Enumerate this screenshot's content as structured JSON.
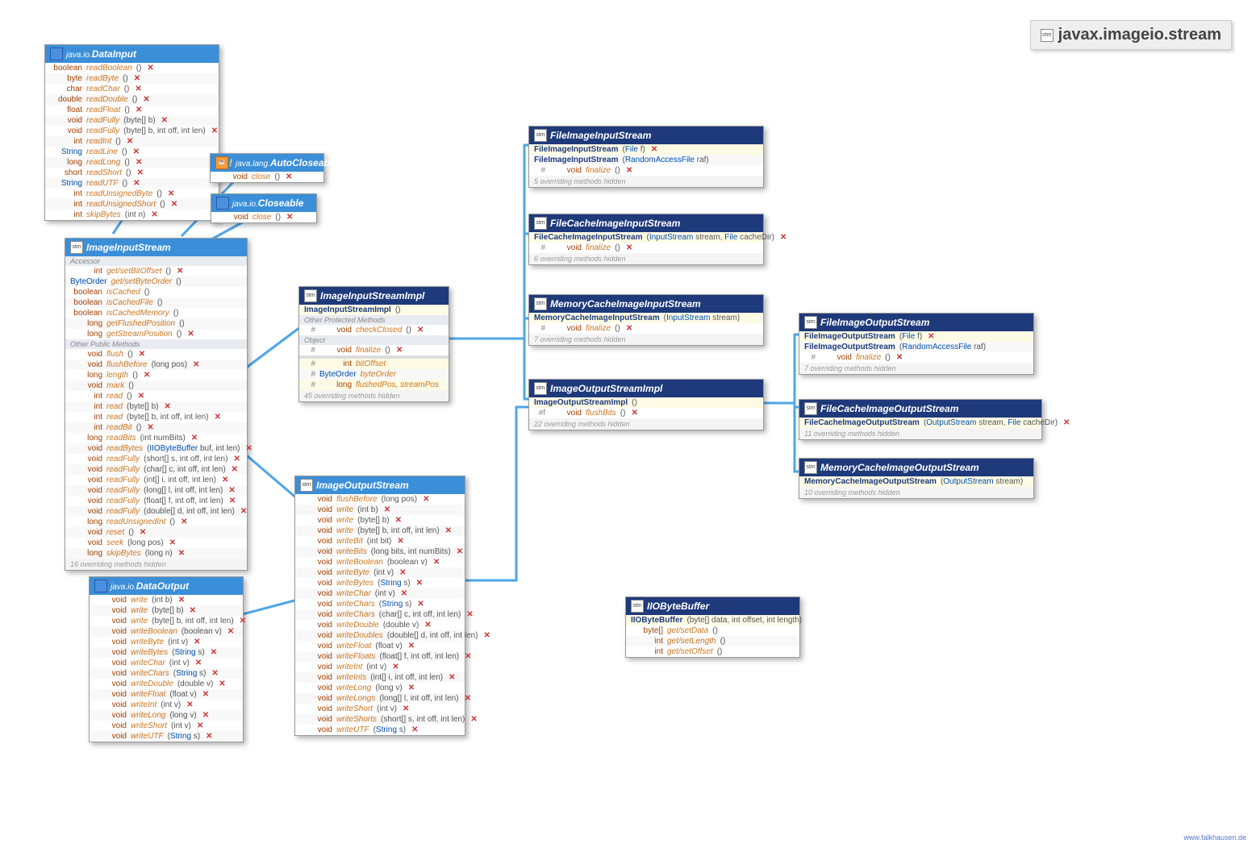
{
  "title": "javax.imageio.stream",
  "watermark": "www.falkhausen.de",
  "boxes": {
    "dataInput": {
      "pkg": "java.io.",
      "name": "DataInput",
      "rows": [
        {
          "ret": "boolean",
          "m": "readBoolean",
          "p": "()",
          "t": true
        },
        {
          "ret": "byte",
          "m": "readByte",
          "p": "()",
          "t": true
        },
        {
          "ret": "char",
          "m": "readChar",
          "p": "()",
          "t": true
        },
        {
          "ret": "double",
          "m": "readDouble",
          "p": "()",
          "t": true
        },
        {
          "ret": "float",
          "m": "readFloat",
          "p": "()",
          "t": true
        },
        {
          "ret": "void",
          "m": "readFully",
          "p": "(byte[] b)",
          "t": true
        },
        {
          "ret": "void",
          "m": "readFully",
          "p": "(byte[] b, int off, int len)",
          "t": true
        },
        {
          "ret": "int",
          "m": "readInt",
          "p": "()",
          "t": true
        },
        {
          "ret": "String",
          "m": "readLine",
          "p": "()",
          "t": true,
          "retblue": true
        },
        {
          "ret": "long",
          "m": "readLong",
          "p": "()",
          "t": true
        },
        {
          "ret": "short",
          "m": "readShort",
          "p": "()",
          "t": true
        },
        {
          "ret": "String",
          "m": "readUTF",
          "p": "()",
          "t": true,
          "retblue": true
        },
        {
          "ret": "int",
          "m": "readUnsignedByte",
          "p": "()",
          "t": true
        },
        {
          "ret": "int",
          "m": "readUnsignedShort",
          "p": "()",
          "t": true
        },
        {
          "ret": "int",
          "m": "skipBytes",
          "p": "(int n)",
          "t": true
        }
      ]
    },
    "autoCloseable": {
      "pkg": "java.lang.",
      "name": "AutoCloseable",
      "rows": [
        {
          "ret": "void",
          "m": "close",
          "p": "()",
          "t": true
        }
      ]
    },
    "closeable": {
      "pkg": "java.io.",
      "name": "Closeable",
      "rows": [
        {
          "ret": "void",
          "m": "close",
          "p": "()",
          "t": true
        }
      ]
    },
    "imageInputStream": {
      "name": "ImageInputStream",
      "sec1": "Accessor",
      "rows1": [
        {
          "ret": "int",
          "m": "get/setBitOffset",
          "p": "()",
          "t": true
        },
        {
          "ret": "ByteOrder",
          "m": "get/setByteOrder",
          "p": "()",
          "retblue": true
        },
        {
          "ret": "boolean",
          "m": "isCached",
          "p": "()"
        },
        {
          "ret": "boolean",
          "m": "isCachedFile",
          "p": "()"
        },
        {
          "ret": "boolean",
          "m": "isCachedMemory",
          "p": "()"
        },
        {
          "ret": "long",
          "m": "getFlushedPosition",
          "p": "()"
        },
        {
          "ret": "long",
          "m": "getStreamPosition",
          "p": "()",
          "t": true
        }
      ],
      "sec2": "Other Public Methods",
      "rows2": [
        {
          "ret": "void",
          "m": "flush",
          "p": "()",
          "t": true
        },
        {
          "ret": "void",
          "m": "flushBefore",
          "p": "(long pos)",
          "t": true
        },
        {
          "ret": "long",
          "m": "length",
          "p": "()",
          "t": true
        },
        {
          "ret": "void",
          "m": "mark",
          "p": "()"
        },
        {
          "ret": "int",
          "m": "read",
          "p": "()",
          "t": true
        },
        {
          "ret": "int",
          "m": "read",
          "p": "(byte[] b)",
          "t": true
        },
        {
          "ret": "int",
          "m": "read",
          "p": "(byte[] b, int off, int len)",
          "t": true
        },
        {
          "ret": "int",
          "m": "readBit",
          "p": "()",
          "t": true
        },
        {
          "ret": "long",
          "m": "readBits",
          "p": "(int numBits)",
          "t": true
        },
        {
          "ret": "void",
          "m": "readBytes",
          "p": "(IIOByteBuffer buf, int len)",
          "t": true
        },
        {
          "ret": "void",
          "m": "readFully",
          "p": "(short[] s, int off, int len)",
          "t": true
        },
        {
          "ret": "void",
          "m": "readFully",
          "p": "(char[] c, int off, int len)",
          "t": true
        },
        {
          "ret": "void",
          "m": "readFully",
          "p": "(int[] i, int off, int len)",
          "t": true
        },
        {
          "ret": "void",
          "m": "readFully",
          "p": "(long[] l, int off, int len)",
          "t": true
        },
        {
          "ret": "void",
          "m": "readFully",
          "p": "(float[] f, int off, int len)",
          "t": true
        },
        {
          "ret": "void",
          "m": "readFully",
          "p": "(double[] d, int off, int len)",
          "t": true
        },
        {
          "ret": "long",
          "m": "readUnsignedInt",
          "p": "()",
          "t": true
        },
        {
          "ret": "void",
          "m": "reset",
          "p": "()",
          "t": true
        },
        {
          "ret": "void",
          "m": "seek",
          "p": "(long pos)",
          "t": true
        },
        {
          "ret": "long",
          "m": "skipBytes",
          "p": "(long n)",
          "t": true
        }
      ],
      "note": "16 overriding methods hidden"
    },
    "dataOutput": {
      "pkg": "java.io.",
      "name": "DataOutput",
      "rows": [
        {
          "ret": "void",
          "m": "write",
          "p": "(int b)",
          "t": true
        },
        {
          "ret": "void",
          "m": "write",
          "p": "(byte[] b)",
          "t": true
        },
        {
          "ret": "void",
          "m": "write",
          "p": "(byte[] b, int off, int len)",
          "t": true
        },
        {
          "ret": "void",
          "m": "writeBoolean",
          "p": "(boolean v)",
          "t": true
        },
        {
          "ret": "void",
          "m": "writeByte",
          "p": "(int v)",
          "t": true
        },
        {
          "ret": "void",
          "m": "writeBytes",
          "p": "(String s)",
          "t": true
        },
        {
          "ret": "void",
          "m": "writeChar",
          "p": "(int v)",
          "t": true
        },
        {
          "ret": "void",
          "m": "writeChars",
          "p": "(String s)",
          "t": true
        },
        {
          "ret": "void",
          "m": "writeDouble",
          "p": "(double v)",
          "t": true
        },
        {
          "ret": "void",
          "m": "writeFloat",
          "p": "(float v)",
          "t": true
        },
        {
          "ret": "void",
          "m": "writeInt",
          "p": "(int v)",
          "t": true
        },
        {
          "ret": "void",
          "m": "writeLong",
          "p": "(long v)",
          "t": true
        },
        {
          "ret": "void",
          "m": "writeShort",
          "p": "(int v)",
          "t": true
        },
        {
          "ret": "void",
          "m": "writeUTF",
          "p": "(String s)",
          "t": true
        }
      ]
    },
    "imageInputStreamImpl": {
      "name": "ImageInputStreamImpl",
      "ctor": [
        {
          "m": "ImageInputStreamImpl",
          "p": "()"
        }
      ],
      "sec1": "Other Protected Methods",
      "rows1": [
        {
          "pref": "#",
          "ret": "void",
          "m": "checkClosed",
          "p": "()",
          "t": true
        }
      ],
      "sec2": "Object",
      "rows2": [
        {
          "pref": "#",
          "ret": "void",
          "m": "finalize",
          "p": "()",
          "t": true
        }
      ],
      "fields": [
        {
          "pref": "#",
          "ret": "int",
          "m": "bitOffset"
        },
        {
          "pref": "#",
          "ret": "ByteOrder",
          "m": "byteOrder",
          "retblue": true
        },
        {
          "pref": "#",
          "ret": "long",
          "m": "flushedPos, streamPos"
        }
      ],
      "note": "45 overriding methods hidden"
    },
    "imageOutputStream": {
      "name": "ImageOutputStream",
      "rows": [
        {
          "ret": "void",
          "m": "flushBefore",
          "p": "(long pos)",
          "t": true
        },
        {
          "ret": "void",
          "m": "write",
          "p": "(int b)",
          "t": true
        },
        {
          "ret": "void",
          "m": "write",
          "p": "(byte[] b)",
          "t": true
        },
        {
          "ret": "void",
          "m": "write",
          "p": "(byte[] b, int off, int len)",
          "t": true
        },
        {
          "ret": "void",
          "m": "writeBit",
          "p": "(int bit)",
          "t": true
        },
        {
          "ret": "void",
          "m": "writeBits",
          "p": "(long bits, int numBits)",
          "t": true
        },
        {
          "ret": "void",
          "m": "writeBoolean",
          "p": "(boolean v)",
          "t": true
        },
        {
          "ret": "void",
          "m": "writeByte",
          "p": "(int v)",
          "t": true
        },
        {
          "ret": "void",
          "m": "writeBytes",
          "p": "(String s)",
          "t": true
        },
        {
          "ret": "void",
          "m": "writeChar",
          "p": "(int v)",
          "t": true
        },
        {
          "ret": "void",
          "m": "writeChars",
          "p": "(String s)",
          "t": true
        },
        {
          "ret": "void",
          "m": "writeChars",
          "p": "(char[] c, int off, int len)",
          "t": true
        },
        {
          "ret": "void",
          "m": "writeDouble",
          "p": "(double v)",
          "t": true
        },
        {
          "ret": "void",
          "m": "writeDoubles",
          "p": "(double[] d, int off, int len)",
          "t": true
        },
        {
          "ret": "void",
          "m": "writeFloat",
          "p": "(float v)",
          "t": true
        },
        {
          "ret": "void",
          "m": "writeFloats",
          "p": "(float[] f, int off, int len)",
          "t": true
        },
        {
          "ret": "void",
          "m": "writeInt",
          "p": "(int v)",
          "t": true
        },
        {
          "ret": "void",
          "m": "writeInts",
          "p": "(int[] i, int off, int len)",
          "t": true
        },
        {
          "ret": "void",
          "m": "writeLong",
          "p": "(long v)",
          "t": true
        },
        {
          "ret": "void",
          "m": "writeLongs",
          "p": "(long[] l, int off, int len)",
          "t": true
        },
        {
          "ret": "void",
          "m": "writeShort",
          "p": "(int v)",
          "t": true
        },
        {
          "ret": "void",
          "m": "writeShorts",
          "p": "(short[] s, int off, int len)",
          "t": true
        },
        {
          "ret": "void",
          "m": "writeUTF",
          "p": "(String s)",
          "t": true
        }
      ]
    },
    "fileImageInputStream": {
      "name": "FileImageInputStream",
      "ctor": [
        {
          "m": "FileImageInputStream",
          "p": "(File f)",
          "t": true
        },
        {
          "m": "FileImageInputStream",
          "p": "(RandomAccessFile raf)"
        }
      ],
      "rows": [
        {
          "pref": "#",
          "ret": "void",
          "m": "finalize",
          "p": "()",
          "t": true
        }
      ],
      "note": "5 overriding methods hidden"
    },
    "fileCacheImageInputStream": {
      "name": "FileCacheImageInputStream",
      "ctor": [
        {
          "m": "FileCacheImageInputStream",
          "p": "(InputStream stream, File cacheDir)",
          "t": true
        }
      ],
      "rows": [
        {
          "pref": "#",
          "ret": "void",
          "m": "finalize",
          "p": "()",
          "t": true
        }
      ],
      "note": "6 overriding methods hidden"
    },
    "memoryCacheImageInputStream": {
      "name": "MemoryCacheImageInputStream",
      "ctor": [
        {
          "m": "MemoryCacheImageInputStream",
          "p": "(InputStream stream)"
        }
      ],
      "rows": [
        {
          "pref": "#",
          "ret": "void",
          "m": "finalize",
          "p": "()",
          "t": true
        }
      ],
      "note": "7 overriding methods hidden"
    },
    "imageOutputStreamImpl": {
      "name": "ImageOutputStreamImpl",
      "ctor": [
        {
          "m": "ImageOutputStreamImpl",
          "p": "()"
        }
      ],
      "rows": [
        {
          "pref": "#f",
          "ret": "void",
          "m": "flushBits",
          "p": "()",
          "t": true
        }
      ],
      "note": "22 overriding methods hidden"
    },
    "iioByteBuffer": {
      "name": "IIOByteBuffer",
      "ctor": [
        {
          "m": "IIOByteBuffer",
          "p": "(byte[] data, int offset, int length)"
        }
      ],
      "rows": [
        {
          "ret": "byte[]",
          "m": "get/setData",
          "p": "()"
        },
        {
          "ret": "int",
          "m": "get/setLength",
          "p": "()"
        },
        {
          "ret": "int",
          "m": "get/setOffset",
          "p": "()"
        }
      ]
    },
    "fileImageOutputStream": {
      "name": "FileImageOutputStream",
      "ctor": [
        {
          "m": "FileImageOutputStream",
          "p": "(File f)",
          "t": true
        },
        {
          "m": "FileImageOutputStream",
          "p": "(RandomAccessFile raf)"
        }
      ],
      "rows": [
        {
          "pref": "#",
          "ret": "void",
          "m": "finalize",
          "p": "()",
          "t": true
        }
      ],
      "note": "7 overriding methods hidden"
    },
    "fileCacheImageOutputStream": {
      "name": "FileCacheImageOutputStream",
      "ctor": [
        {
          "m": "FileCacheImageOutputStream",
          "p": "(OutputStream stream, File cacheDir)",
          "t": true
        }
      ],
      "note": "11 overriding methods hidden"
    },
    "memoryCacheImageOutputStream": {
      "name": "MemoryCacheImageOutputStream",
      "ctor": [
        {
          "m": "MemoryCacheImageOutputStream",
          "p": "(OutputStream stream)"
        }
      ],
      "note": "10 overriding methods hidden"
    }
  }
}
